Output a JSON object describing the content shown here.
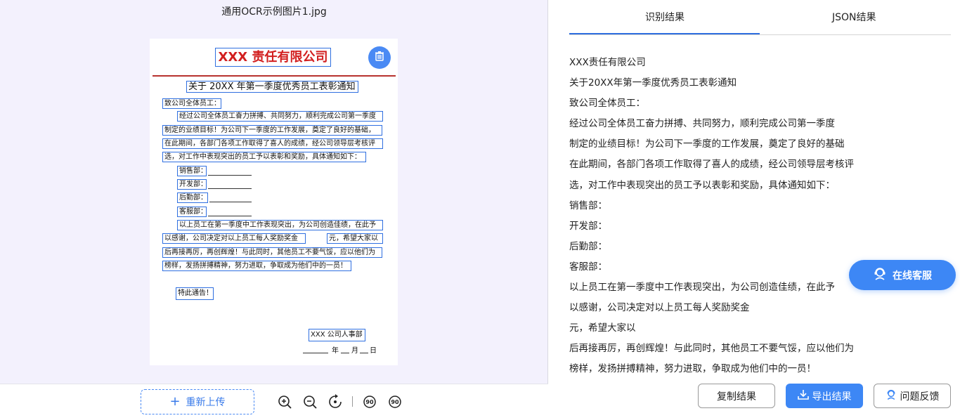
{
  "left_pane": {
    "filename": "通用OCR示例图片1.jpg",
    "reupload_label": "重新上传",
    "tools": [
      "zoom-in-icon",
      "zoom-out-icon",
      "reset-rotate-icon",
      "rotate-left-90-icon",
      "rotate-right-90-icon"
    ],
    "rotate_left_label": "90",
    "rotate_right_label": "90"
  },
  "document": {
    "company_title": "XXX 责任有限公司",
    "notice_title": "关于 20XX 年第一季度优秀员工表彰通知",
    "greeting": "致公司全体员工：",
    "p1_l1": "经过公司全体员工奋力拼搏、共同努力，顺利完成公司第一季度",
    "p1_l2": "制定的业绩目标！为公司下一季度的工作发展，奠定了良好的基础，",
    "p1_l3": "在此期间，各部门各项工作取得了喜人的成绩，经公司领导层考核评",
    "p1_l4": "选，对工作中表现突出的员工予以表彰和奖励，具体通知如下：",
    "dept1": "销售部：",
    "dept2": "开发部：",
    "dept3": "后勤部：",
    "dept4": "客服部：",
    "p2_l1": "以上员工在第一季度中工作表现突出，为公司创造佳绩，在此予",
    "p2_l2a": "以感谢，公司决定对以上员工每人奖励奖金",
    "p2_l2b": "元，希望大家以",
    "p2_l3": "后再接再厉，再创辉煌！与此同时，其他员工不要气馁，应以他们为",
    "p2_l4": "榜样，发扬拼搏精神，努力进取，争取成为他们中的一员！",
    "closing": "特此通告！",
    "signature": "XXX 公司人事部",
    "date_year": "年",
    "date_month": "月",
    "date_day": "日"
  },
  "right_pane": {
    "tabs": [
      {
        "label": "识别结果",
        "active": true
      },
      {
        "label": "JSON结果",
        "active": false
      }
    ],
    "results": [
      "XXX责任有限公司",
      "关于20XX年第一季度优秀员工表彰通知",
      "致公司全体员工：",
      "经过公司全体员工奋力拼搏、共同努力，顺利完成公司第一季度",
      "制定的业绩目标！为公司下一季度的工作发展，奠定了良好的基础",
      "在此期间，各部门各项工作取得了喜人的成绩，经公司领导层考核评",
      "选，对工作中表现突出的员工予以表彰和奖励，具体通知如下：",
      "销售部：",
      "开发部：",
      "后勤部：",
      "客服部：",
      "以上员工在第一季度中工作表现突出，为公司创造佳绩，在此予",
      "以感谢，公司决定对以上员工每人奖励奖金",
      "元，希望大家以",
      "后再接再厉，再创辉煌！与此同时，其他员工不要气馁，应以他们为",
      "榜样，发扬拼搏精神，努力进取，争取成为他们中的一员！"
    ],
    "service_label": "在线客服",
    "copy_label": "复制结果",
    "export_label": "导出结果",
    "feedback_label": "问题反馈"
  },
  "colors": {
    "accent": "#3d87f5",
    "left_bg": "#f3f1fd",
    "box_blue": "#2f6fe0",
    "title_red": "#d21f1f"
  }
}
